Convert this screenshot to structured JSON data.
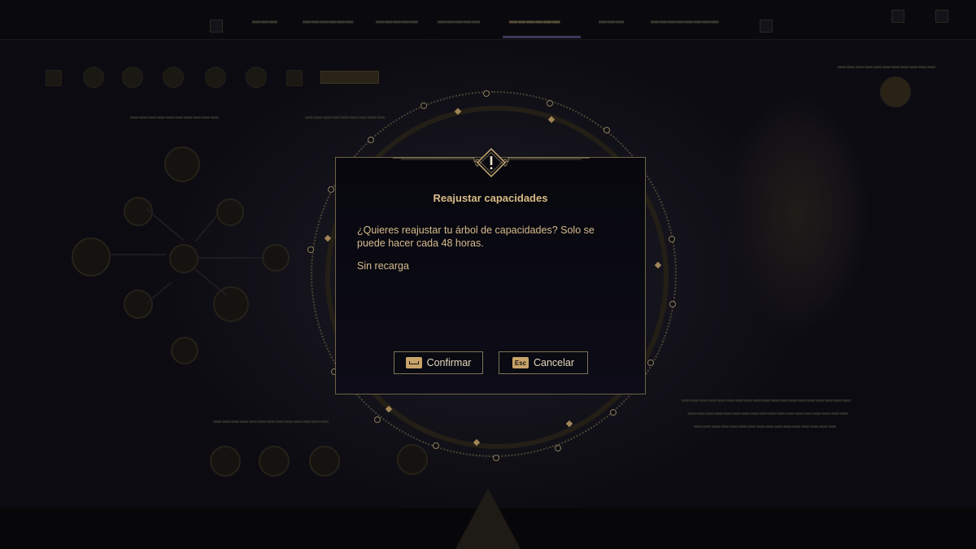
{
  "modal": {
    "title": "Reajustar capacidades",
    "message": "¿Quieres reajustar tu árbol de capacidades? Solo se puede hacer cada 48 horas.",
    "note": "Sin recarga",
    "confirm_label": "Confirmar",
    "confirm_key": "space-bar-key-icon",
    "cancel_label": "Cancelar",
    "cancel_key": "Esc",
    "emblem_icon": "exclamation-icon"
  },
  "colors": {
    "accent_gold": "#d9bb86",
    "modal_border": "#6d6248",
    "key_bg": "#c9a46a"
  }
}
